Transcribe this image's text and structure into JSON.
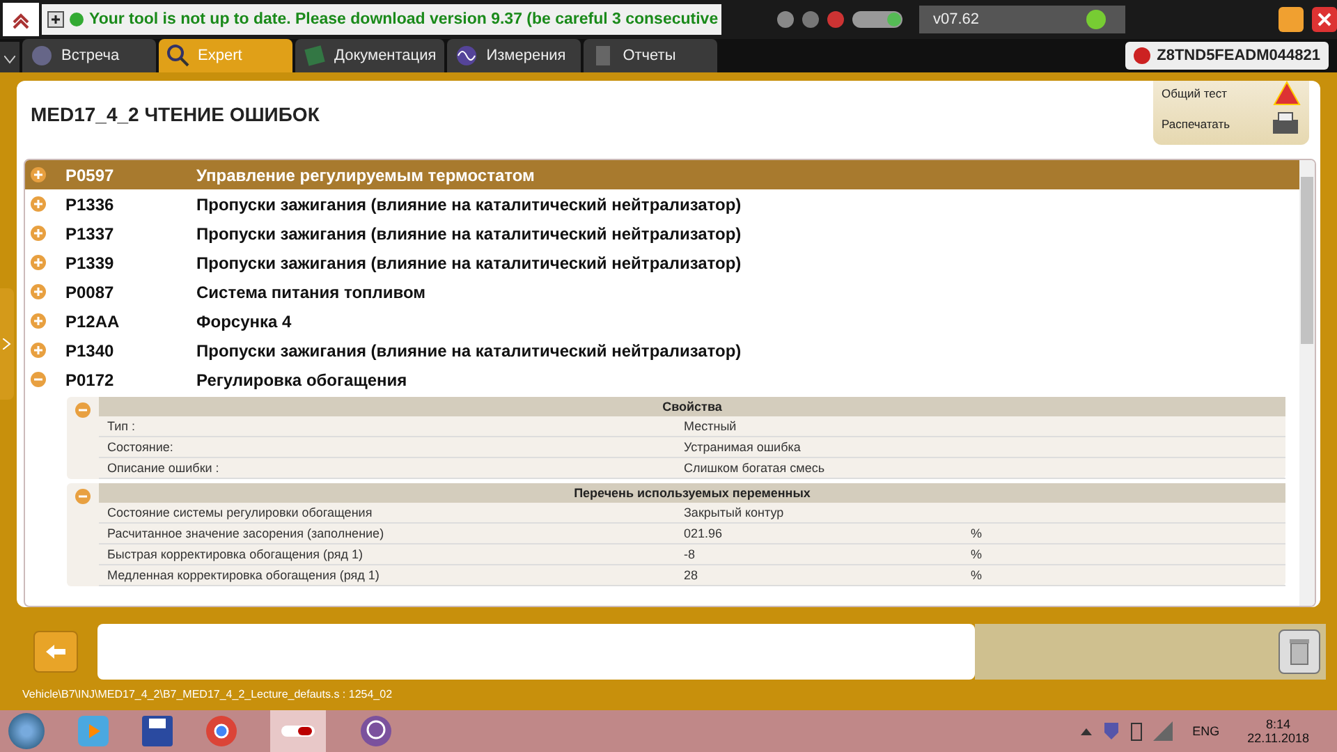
{
  "notification": {
    "message": "Your tool is not up to date. Please download version 9.37 (be careful 3 consecutive"
  },
  "version": "v07.62",
  "tabs": [
    {
      "label": "Встреча",
      "selected": false,
      "kind": "meeting"
    },
    {
      "label": "Expert",
      "selected": true,
      "kind": "search"
    },
    {
      "label": "Документация",
      "selected": false,
      "kind": "book"
    },
    {
      "label": "Измерения",
      "selected": false,
      "kind": "wave"
    },
    {
      "label": "Отчеты",
      "selected": false,
      "kind": "report"
    }
  ],
  "vin": "Z8TND5FEADM044821",
  "page_title": "MED17_4_2  ЧТЕНИЕ ОШИБОК",
  "side_actions": [
    {
      "label": "Общий тест",
      "kind": "warning"
    },
    {
      "label": "Распечатать",
      "kind": "print"
    }
  ],
  "faults": [
    {
      "code": "P0597",
      "description": "Управление регулируемым термостатом",
      "selected": true,
      "expanded": false
    },
    {
      "code": "P1336",
      "description": "Пропуски зажигания (влияние на каталитический нейтрализатор)",
      "selected": false,
      "expanded": false
    },
    {
      "code": "P1337",
      "description": "Пропуски зажигания (влияние на каталитический нейтрализатор)",
      "selected": false,
      "expanded": false
    },
    {
      "code": "P1339",
      "description": "Пропуски зажигания (влияние на каталитический нейтрализатор)",
      "selected": false,
      "expanded": false
    },
    {
      "code": "P0087",
      "description": "Система питания топливом",
      "selected": false,
      "expanded": false
    },
    {
      "code": "P12AA",
      "description": "Форсунка 4",
      "selected": false,
      "expanded": false
    },
    {
      "code": "P1340",
      "description": "Пропуски зажигания (влияние на каталитический нейтрализатор)",
      "selected": false,
      "expanded": false
    },
    {
      "code": "P0172",
      "description": "Регулировка обогащения",
      "selected": false,
      "expanded": true,
      "sections": [
        {
          "title": "Свойства",
          "expanded": true,
          "rows": [
            {
              "name": "Тип :",
              "value": "Местный"
            },
            {
              "name": "Состояние:",
              "value": "Устранимая ошибка"
            },
            {
              "name": "Описание ошибки :",
              "value": "Слишком богатая смесь"
            }
          ]
        },
        {
          "title": "Перечень используемых переменных",
          "expanded": true,
          "rows": [
            {
              "name": "Состояние системы регулировки обогащения",
              "value": "Закрытый контур"
            },
            {
              "name": "Расчитанное значение засорения (заполнение)",
              "value": "021.96",
              "unit": "%"
            },
            {
              "name": "Быстрая корректировка обогащения (ряд 1)",
              "value": "-8",
              "unit": "%"
            },
            {
              "name": "Медленная корректировка обогащения (ряд 1)",
              "value": "28",
              "unit": "%"
            }
          ]
        }
      ]
    }
  ],
  "path": "Vehicle\\B7\\INJ\\MED17_4_2\\B7_MED17_4_2_Lecture_defauts.s : 1254_02",
  "taskbar": {
    "language": "ENG",
    "time": "8:14",
    "date": "22.11.2018"
  }
}
